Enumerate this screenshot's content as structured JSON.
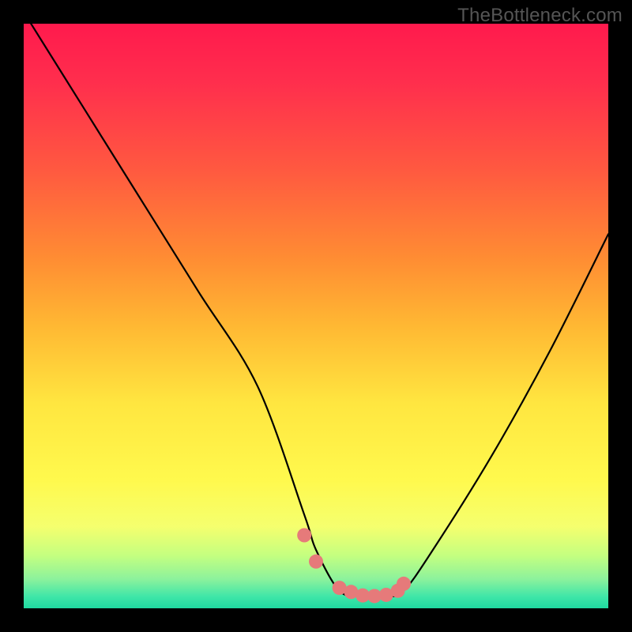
{
  "watermark": "TheBottleneck.com",
  "chart_data": {
    "type": "line",
    "title": "",
    "xlabel": "",
    "ylabel": "",
    "xlim": [
      0,
      100
    ],
    "ylim": [
      0,
      100
    ],
    "series": [
      {
        "name": "curve",
        "x": [
          0,
          10,
          20,
          30,
          40,
          48,
          50,
          54,
          58,
          62,
          65,
          70,
          80,
          90,
          100
        ],
        "values": [
          102,
          86,
          70,
          54,
          38,
          16,
          10,
          3,
          2,
          2,
          3,
          10,
          26,
          44,
          64
        ]
      }
    ],
    "markers": {
      "name": "highlight-dots",
      "color": "#e67a7a",
      "x": [
        48,
        50,
        54,
        56,
        58,
        60,
        62,
        64,
        65
      ],
      "values": [
        12.5,
        8.0,
        3.5,
        2.8,
        2.2,
        2.1,
        2.3,
        3.0,
        4.2
      ]
    },
    "grid": false,
    "legend": false
  }
}
